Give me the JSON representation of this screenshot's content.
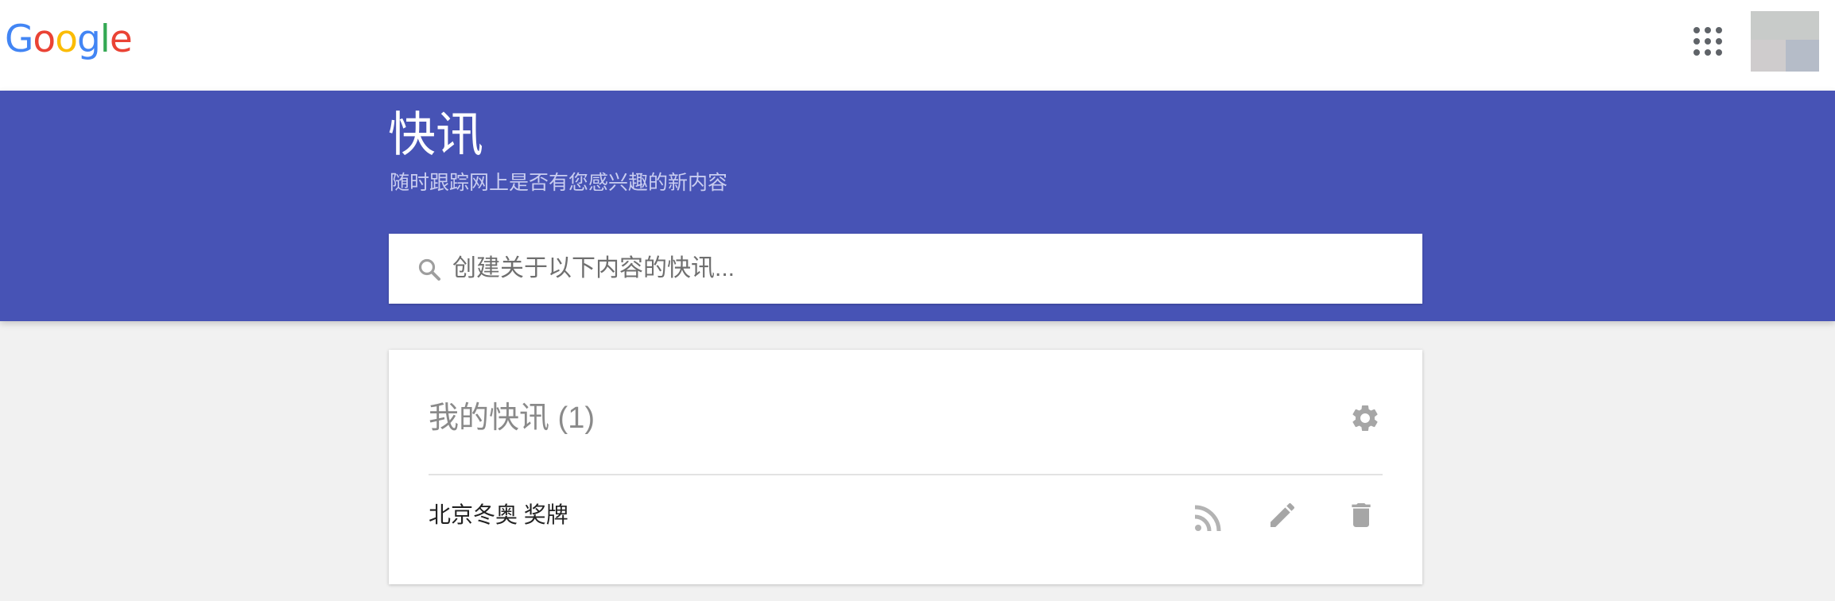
{
  "topbar": {
    "logo_letters": [
      "G",
      "o",
      "o",
      "g",
      "l",
      "e"
    ],
    "apps_icon": "apps-grid-icon",
    "avatar_icon": "account-avatar"
  },
  "header": {
    "title": "快讯",
    "subtitle": "随时跟踪网上是否有您感兴趣的新内容"
  },
  "search": {
    "placeholder": "创建关于以下内容的快讯...",
    "value": "",
    "icon": "search-icon"
  },
  "alerts_card": {
    "title": "我的快讯 (1)",
    "settings_icon": "gear-icon",
    "items": [
      {
        "query": "北京冬奥 奖牌",
        "actions": [
          "rss-icon",
          "pencil-icon",
          "trash-icon"
        ]
      }
    ]
  },
  "colors": {
    "header_bg": "#4753b5",
    "page_bg": "#f1f1f1",
    "card_bg": "#ffffff",
    "icon_gray": "#a6a6a6",
    "google_blue": "#4285f4",
    "google_red": "#ea4335",
    "google_yellow": "#fbbc05",
    "google_green": "#34a853"
  }
}
